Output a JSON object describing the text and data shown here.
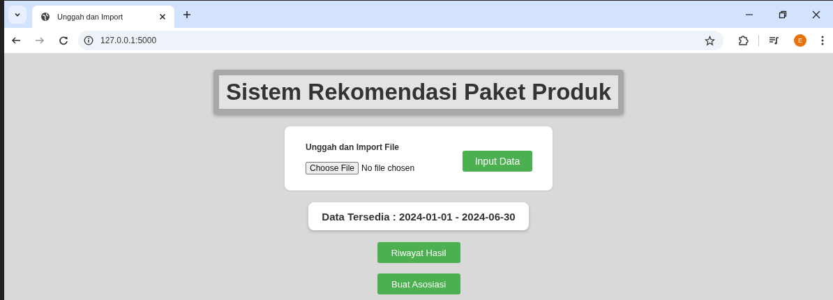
{
  "browser": {
    "tab": {
      "title": "Unggah dan Import",
      "selected": true
    },
    "address": "127.0.0.1:5000",
    "profile_initial": "E"
  },
  "page": {
    "title": "Sistem Rekomendasi Paket Produk",
    "upload": {
      "heading": "Unggah dan Import File",
      "choose_button": "Choose File",
      "file_status": "No file chosen",
      "submit": "Input Data"
    },
    "availability": "Data Tersedia : 2024-01-01 - 2024-06-30",
    "actions": [
      "Riwayat Hasil",
      "Buat Asosiasi"
    ]
  }
}
